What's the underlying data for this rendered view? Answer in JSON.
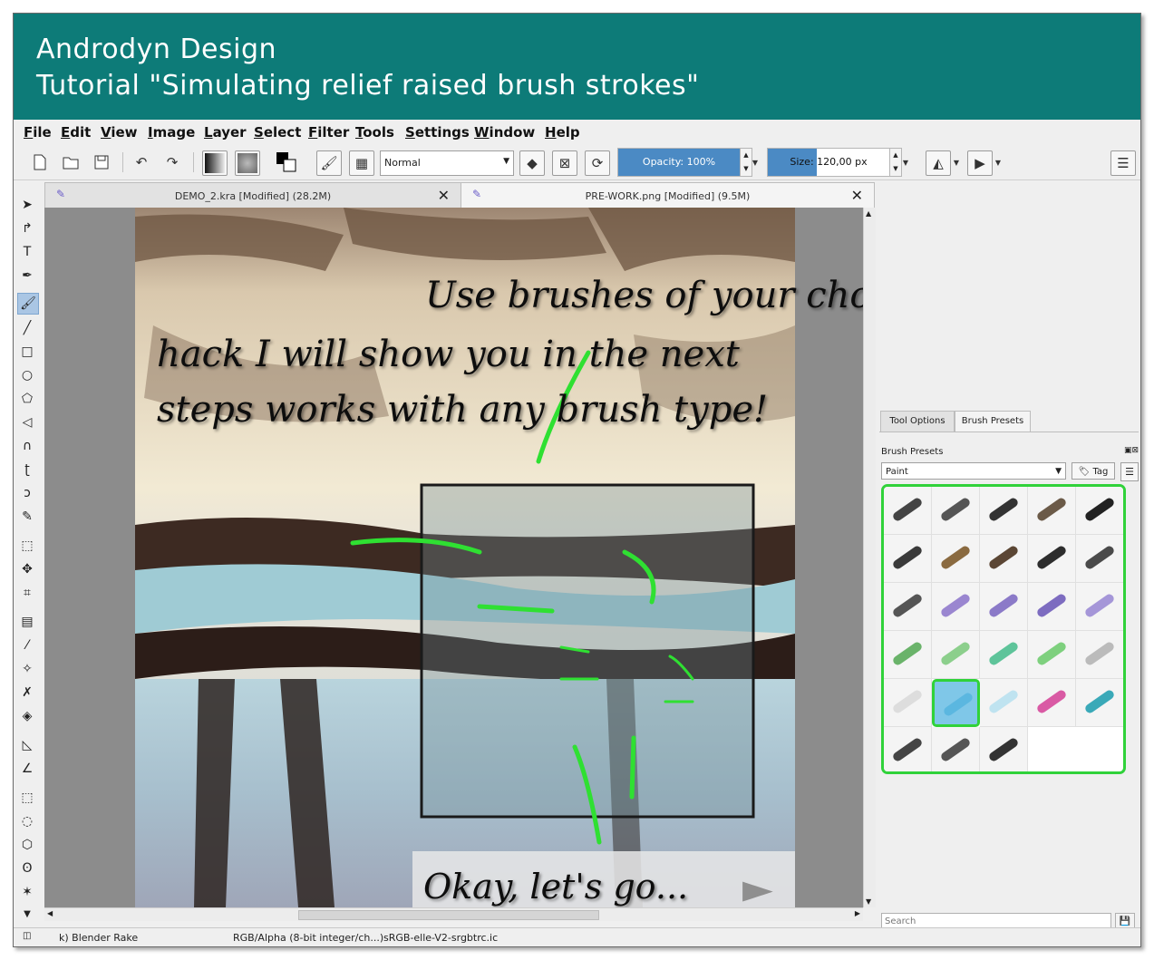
{
  "banner": {
    "line1": "Androdyn Design",
    "line2": "Tutorial \"Simulating relief raised brush strokes\""
  },
  "menu": [
    "File",
    "Edit",
    "View",
    "Image",
    "Layer",
    "Select",
    "Filter",
    "Tools",
    "Settings",
    "Window",
    "Help"
  ],
  "toolbar": {
    "blend_mode": "Normal",
    "opacity_label": "Opacity:  100%",
    "opacity_fraction": 1.0,
    "size_label": "Size:  120,00 px",
    "size_fraction": 0.4
  },
  "tabs": [
    {
      "title": "DEMO_2.kra [Modified]  (28.2M)",
      "close": "✕"
    },
    {
      "title": "PRE-WORK.png [Modified]  (9.5M)",
      "close": "✕"
    }
  ],
  "canvas": {
    "caption_top": [
      "Use brushes of your choice... the",
      "hack I will show you in the next",
      "steps works with any brush type!"
    ],
    "caption_bottom": "Okay, let's go...",
    "next_arrow": "►"
  },
  "right_panel": {
    "tabs": [
      "Tool Options",
      "Brush Presets"
    ],
    "section_label": "Brush Presets",
    "tag_combo": "Paint",
    "tag_button": "Tag",
    "search_placeholder": "Search"
  },
  "status": {
    "brush": "k) Blender Rake",
    "color_model": "RGB/Alpha (8-bit integer/ch...)",
    "profile": "sRGB-elle-V2-srgbtrc.ic"
  },
  "icons": {
    "new": "new-document-icon",
    "open": "open-folder-icon",
    "save": "save-icon",
    "undo": "undo-icon",
    "redo": "redo-icon"
  }
}
